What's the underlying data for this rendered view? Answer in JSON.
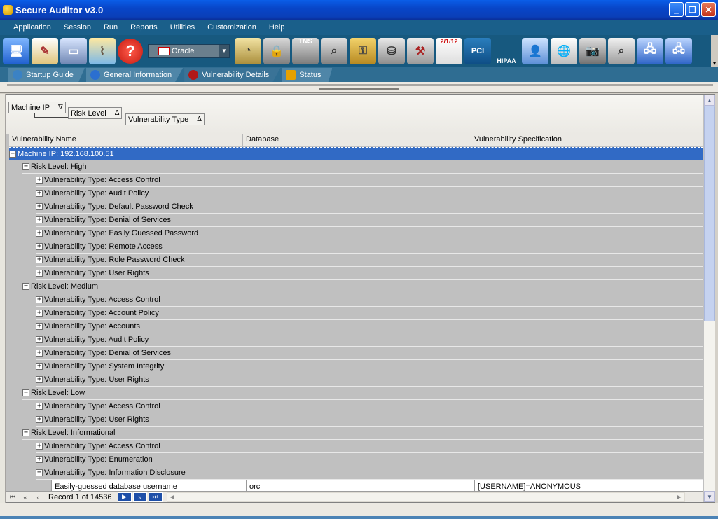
{
  "window": {
    "title": "Secure Auditor v3.0"
  },
  "menu": [
    "Application",
    "Session",
    "Run",
    "Reports",
    "Utilities",
    "Customization",
    "Help"
  ],
  "toolbar": {
    "combo_value": "Oracle",
    "icons": [
      "computers-icon",
      "notes-icon",
      "monitor-icon",
      "broom-icon",
      "help-icon",
      "safe-gauge-icon",
      "lock-icon",
      "tns-lock-icon",
      "tns-lock-search-icon",
      "key-search-icon",
      "database-search-icon",
      "database-hammer-icon",
      "calendar-icon",
      "pci-icon",
      "hipaa-icon",
      "user-network-icon",
      "network-globe-icon",
      "cameras-icon",
      "tower-search-icon",
      "network-pc-icon",
      "network-globe-pc-icon"
    ],
    "tns_label": "TNS",
    "pci_label": "PCI",
    "hipaa_label": "HIPAA",
    "calendar_label": "2/1/12"
  },
  "tabs": [
    {
      "label": "Startup Guide",
      "icon": "globe-icon",
      "color": "#3b82c4"
    },
    {
      "label": "General Information",
      "icon": "info-icon",
      "color": "#2b6fd0"
    },
    {
      "label": "Vulnerability Details",
      "icon": "bug-icon",
      "color": "#b01818"
    },
    {
      "label": "Status",
      "icon": "warning-icon",
      "color": "#e6a100"
    }
  ],
  "grouping": [
    {
      "label": "Machine IP",
      "arrow": "∇"
    },
    {
      "label": "Risk Level",
      "arrow": "Δ"
    },
    {
      "label": "Vulnerability Type",
      "arrow": "Δ"
    }
  ],
  "columns": [
    "Vulnerability Name",
    "Database",
    "Vulnerability Specification"
  ],
  "tree": {
    "machine": "Machine IP: 192.168.100.51",
    "groups": [
      {
        "risk": "Risk Level:   High",
        "types": [
          "Vulnerability Type: Access Control",
          "Vulnerability Type: Audit Policy",
          "Vulnerability Type: Default Password Check",
          "Vulnerability Type: Denial of Services",
          "Vulnerability Type:  Easily Guessed Password",
          "Vulnerability Type: Remote Access",
          "Vulnerability Type: Role Password Check",
          "Vulnerability Type: User Rights"
        ]
      },
      {
        "risk": "Risk Level:   Medium",
        "types": [
          "Vulnerability Type: Access Control",
          "Vulnerability Type: Account Policy",
          "Vulnerability Type: Accounts",
          "Vulnerability Type: Audit Policy",
          "Vulnerability Type: Denial of Services",
          "Vulnerability Type: System Integrity",
          "Vulnerability Type: User Rights"
        ]
      },
      {
        "risk": "Risk Level:  Low",
        "types": [
          "Vulnerability Type: Access Control",
          "Vulnerability Type: User Rights"
        ]
      },
      {
        "risk": "Risk Level: Informational",
        "types": [
          "Vulnerability Type: Access Control",
          "Vulnerability Type: Enumeration",
          "Vulnerability Type: Information Disclosure"
        ]
      }
    ],
    "data_row": {
      "name": "Easily-guessed database username",
      "database": "orcl",
      "spec": "[USERNAME]=ANONYMOUS"
    }
  },
  "navigator": {
    "record_text": "Record 1 of 14536"
  },
  "colors": {
    "selection": "#316ac5",
    "menubar": "#1a5f8a",
    "toolbar": "#17597f"
  }
}
